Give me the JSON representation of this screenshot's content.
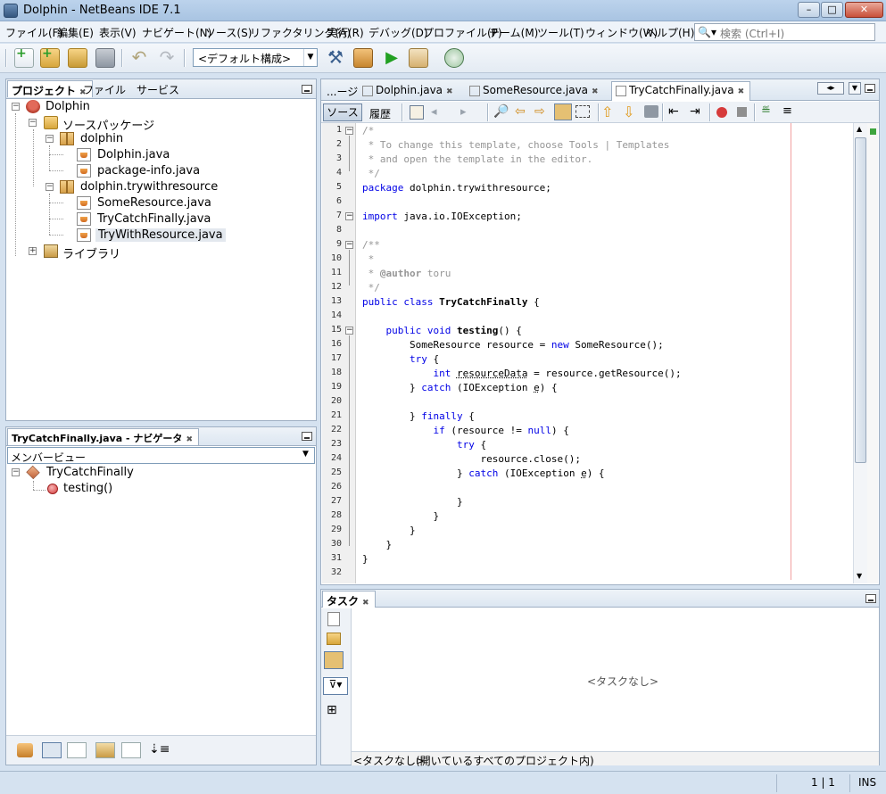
{
  "window": {
    "title": "Dolphin - NetBeans IDE 7.1"
  },
  "menu": [
    "ファイル(F)",
    "編集(E)",
    "表示(V)",
    "ナビゲート(N)",
    "ソース(S)",
    "リファクタリング(A)",
    "実行(R)",
    "デバッグ(D)",
    "プロファイル(P)",
    "チーム(M)",
    "ツール(T)",
    "ウィンドウ(W)",
    "ヘルプ(H)"
  ],
  "search": {
    "placeholder": "検索 (Ctrl+I)"
  },
  "toolbar": {
    "config": "<デフォルト構成>"
  },
  "projects_panel": {
    "tabs": [
      "プロジェクト",
      "ファイル",
      "サービス"
    ],
    "tree": [
      {
        "label": "Dolphin",
        "icon": "project-icon"
      },
      {
        "label": "ソースパッケージ",
        "icon": "folder-icon"
      },
      {
        "label": "dolphin",
        "icon": "package-icon"
      },
      {
        "label": "Dolphin.java",
        "icon": "java-file-icon"
      },
      {
        "label": "package-info.java",
        "icon": "java-file-icon"
      },
      {
        "label": "dolphin.trywithresource",
        "icon": "package-icon"
      },
      {
        "label": "SomeResource.java",
        "icon": "java-file-icon"
      },
      {
        "label": "TryCatchFinally.java",
        "icon": "java-file-icon"
      },
      {
        "label": "TryWithResource.java",
        "icon": "java-file-icon"
      },
      {
        "label": "ライブラリ",
        "icon": "library-icon"
      }
    ]
  },
  "navigator_panel": {
    "title": "TryCatchFinally.java - ナビゲータ",
    "view": "メンバービュー",
    "tree": [
      {
        "label": "TryCatchFinally",
        "icon": "class-icon"
      },
      {
        "label": "testing()",
        "icon": "method-icon"
      }
    ]
  },
  "editor": {
    "tabs": [
      "...ージ",
      "Dolphin.java",
      "SomeResource.java",
      "TryCatchFinally.java"
    ],
    "source_tab": "ソース",
    "history_tab": "履歴",
    "line_numbers": [
      "1",
      "2",
      "3",
      "4",
      "5",
      "6",
      "7",
      "8",
      "9",
      "10",
      "11",
      "12",
      "13",
      "14",
      "15",
      "16",
      "17",
      "18",
      "19",
      "20",
      "21",
      "22",
      "23",
      "24",
      "25",
      "26",
      "27",
      "28",
      "29",
      "30",
      "31",
      "32"
    ]
  },
  "tasks_panel": {
    "tab": "タスク",
    "empty": "<タスクなし>",
    "footer_left": "<タスクなし>",
    "footer_right": "(開いているすべてのプロジェクト内)"
  },
  "status": {
    "position": "1 | 1",
    "mode": "INS"
  },
  "colors": {
    "keyword": "#0000e6",
    "comment": "#969696",
    "margin_line": "#f2a0a0"
  }
}
